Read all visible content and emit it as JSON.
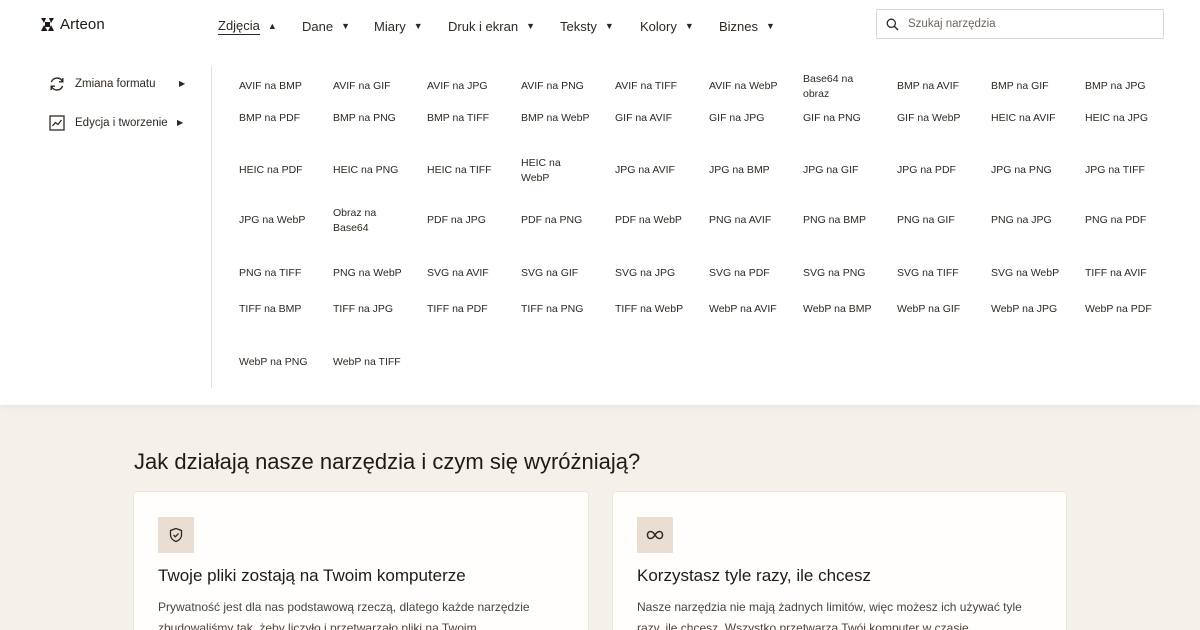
{
  "brand": {
    "name": "Arteon"
  },
  "nav": [
    {
      "label": "Zdjęcia",
      "active": true,
      "caret": "▲"
    },
    {
      "label": "Dane",
      "caret": "▼"
    },
    {
      "label": "Miary",
      "caret": "▼"
    },
    {
      "label": "Druk i ekran",
      "caret": "▼"
    },
    {
      "label": "Teksty",
      "caret": "▼"
    },
    {
      "label": "Kolory",
      "caret": "▼"
    },
    {
      "label": "Biznes",
      "caret": "▼"
    }
  ],
  "search": {
    "placeholder": "Szukaj narzędzia",
    "icon": "search-icon"
  },
  "sidebar": [
    {
      "label": "Zmiana formatu",
      "icon": "refresh-icon",
      "arrow": "▶"
    },
    {
      "label": "Edycja i tworzenie",
      "icon": "chart-edit-icon",
      "arrow": "▶"
    }
  ],
  "tools": [
    "AVIF na BMP",
    "AVIF na GIF",
    "AVIF na JPG",
    "AVIF na PNG",
    "AVIF na TIFF",
    "AVIF na WebP",
    "Base64 na obraz",
    "BMP na AVIF",
    "BMP na GIF",
    "BMP na JPG",
    "BMP na PDF",
    "BMP na PNG",
    "BMP na TIFF",
    "BMP na WebP",
    "GIF na AVIF",
    "GIF na JPG",
    "GIF na PNG",
    "GIF na WebP",
    "HEIC na AVIF",
    "HEIC na JPG",
    "HEIC na PDF",
    "HEIC na PNG",
    "HEIC na TIFF",
    "HEIC na WebP",
    "JPG na AVIF",
    "JPG na BMP",
    "JPG na GIF",
    "JPG na PDF",
    "JPG na PNG",
    "JPG na TIFF",
    "JPG na WebP",
    "Obraz na Base64",
    "PDF na JPG",
    "PDF na PNG",
    "PDF na WebP",
    "PNG na AVIF",
    "PNG na BMP",
    "PNG na GIF",
    "PNG na JPG",
    "PNG na PDF",
    "PNG na TIFF",
    "PNG na WebP",
    "SVG na AVIF",
    "SVG na GIF",
    "SVG na JPG",
    "SVG na PDF",
    "SVG na PNG",
    "SVG na TIFF",
    "SVG na WebP",
    "TIFF na AVIF",
    "TIFF na BMP",
    "TIFF na JPG",
    "TIFF na PDF",
    "TIFF na PNG",
    "TIFF na WebP",
    "WebP na AVIF",
    "WebP na BMP",
    "WebP na GIF",
    "WebP na JPG",
    "WebP na PDF",
    "WebP na PNG",
    "WebP na TIFF"
  ],
  "section": {
    "title": "Jak działają nasze narzędzia i czym się wyróżniają?"
  },
  "cards": [
    {
      "icon": "shield-check-icon",
      "title": "Twoje pliki zostają na Twoim komputerze",
      "text": "Prywatność jest dla nas podstawową rzeczą, dlatego każde narzędzie zbudowaliśmy tak, żeby liczyło i przetwarzało pliki na Twoim"
    },
    {
      "icon": "infinity-icon",
      "title": "Korzystasz tyle razy, ile chcesz",
      "text": "Nasze narzędzia nie mają żadnych limitów, więc możesz ich używać tyle razy, ile chcesz. Wszystko przetwarza Twój komputer w czasie"
    }
  ],
  "colors": {
    "page_bg": "#f4f0ea",
    "icon_tile": "#e9ded1",
    "text": "#2a211b"
  }
}
